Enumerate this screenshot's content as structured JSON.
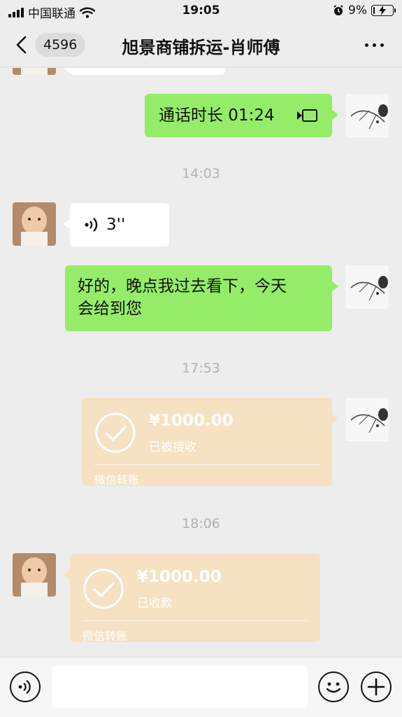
{
  "status_bar": {
    "carrier": "中国联通",
    "time": "19:05",
    "battery_percent": "9%",
    "battery_level": 0.09,
    "icons": [
      "signal-icon",
      "wifi-icon",
      "alarm-icon",
      "battery-charging-icon"
    ]
  },
  "nav": {
    "unread_count": "4596",
    "title": "旭景商铺拆运-肖师傅",
    "icons": [
      "back-chevron-icon",
      "more-dots-icon"
    ]
  },
  "messages": {
    "call": {
      "text": "通话时长 01:24",
      "icon": "video-call-icon"
    },
    "ts1": "14:03",
    "voice": {
      "duration": "3''",
      "icon": "voice-wave-icon"
    },
    "reply": {
      "line1": "好的，晚点我过去看下，今天",
      "line2": "会给到您"
    },
    "ts2": "17:53",
    "transfer_out": {
      "amount": "¥1000.00",
      "status": "已被接收",
      "label": "微信转账",
      "icon": "check-circle-icon"
    },
    "ts3": "18:06",
    "transfer_in": {
      "amount": "¥1000.00",
      "status": "已收款",
      "label": "微信转账",
      "icon": "check-circle-icon"
    }
  },
  "input_bar": {
    "placeholder": "",
    "icons": [
      "voice-input-icon",
      "emoji-icon",
      "plus-icon"
    ]
  },
  "colors": {
    "background": "#ededed",
    "sent_bubble": "#95ec69",
    "received_bubble": "#ffffff",
    "transfer_bubble": "#f6e1c3",
    "timestamp": "#b2b2b2"
  }
}
